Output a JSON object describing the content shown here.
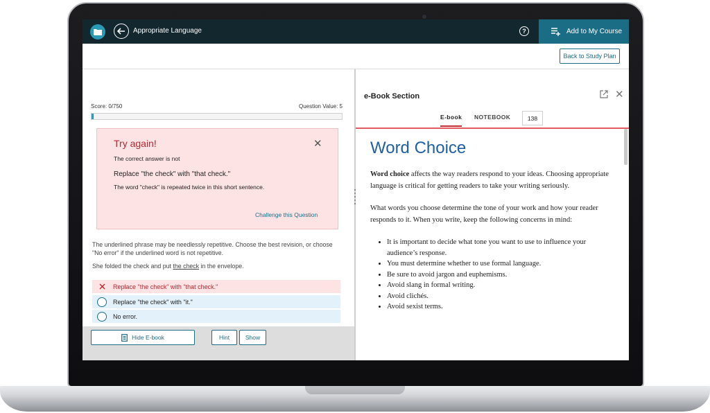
{
  "topbar": {
    "title": "Appropriate Language",
    "help_label": "?",
    "add_course_label": "Add to My Course"
  },
  "subbar": {
    "study_plan_label": "Back to Study Plan"
  },
  "quiz": {
    "score_label": "Score: 0/750",
    "question_value_label": "Question Value: 5",
    "progress_fraction": 0.0,
    "feedback": {
      "title": "Try again!",
      "correct_answer_intro": "The correct answer is not",
      "answer": "Replace \"the check\" with \"that check.\"",
      "explanation": "The word \"check\" is repeated twice in this short sentence.",
      "challenge_label": "Challenge this Question"
    },
    "prompt": "The underlined phrase may be needlessly repetitive. Choose the best revision, or choose \"No error\" if the underlined word is not repetitive.",
    "sentence_before": "She folded the check and put ",
    "sentence_underlined": "the check",
    "sentence_after": " in the envelope.",
    "options": [
      {
        "label": "Replace \"the check\" with \"that check.\"",
        "state": "wrong"
      },
      {
        "label": "Replace \"the check\" with \"it.\"",
        "state": "unselected"
      },
      {
        "label": "No error.",
        "state": "unselected"
      }
    ],
    "hide_ebook_label": "Hide E-book",
    "hint_label": "Hint",
    "show_label": "Show"
  },
  "ebook": {
    "section_title": "e-Book Section",
    "tabs": [
      "E-book",
      "NOTEBOOK"
    ],
    "page_number": "138",
    "heading": "Word Choice",
    "para1_bold": "Word choice",
    "para1_rest": " affects the way readers respond to your ideas. Choosing appropriate language is critical for getting readers to take your writing seriously.",
    "para2": "What words you choose determine the tone of your work and how your reader responds to it. When you write, keep the following concerns in mind:",
    "bullets": [
      "It is important to decide what tone you want to use to influence your audience’s response.",
      "You must determine whether to use formal language.",
      "Be sure to avoid jargon and euphemisms.",
      "Avoid slang in formal writing.",
      "Avoid clichés.",
      "Avoid sexist terms."
    ]
  },
  "colors": {
    "topbar_bg": "#13272f",
    "accent": "#1b6d85",
    "error": "#b8272f",
    "heading_blue": "#1f5fa3"
  }
}
